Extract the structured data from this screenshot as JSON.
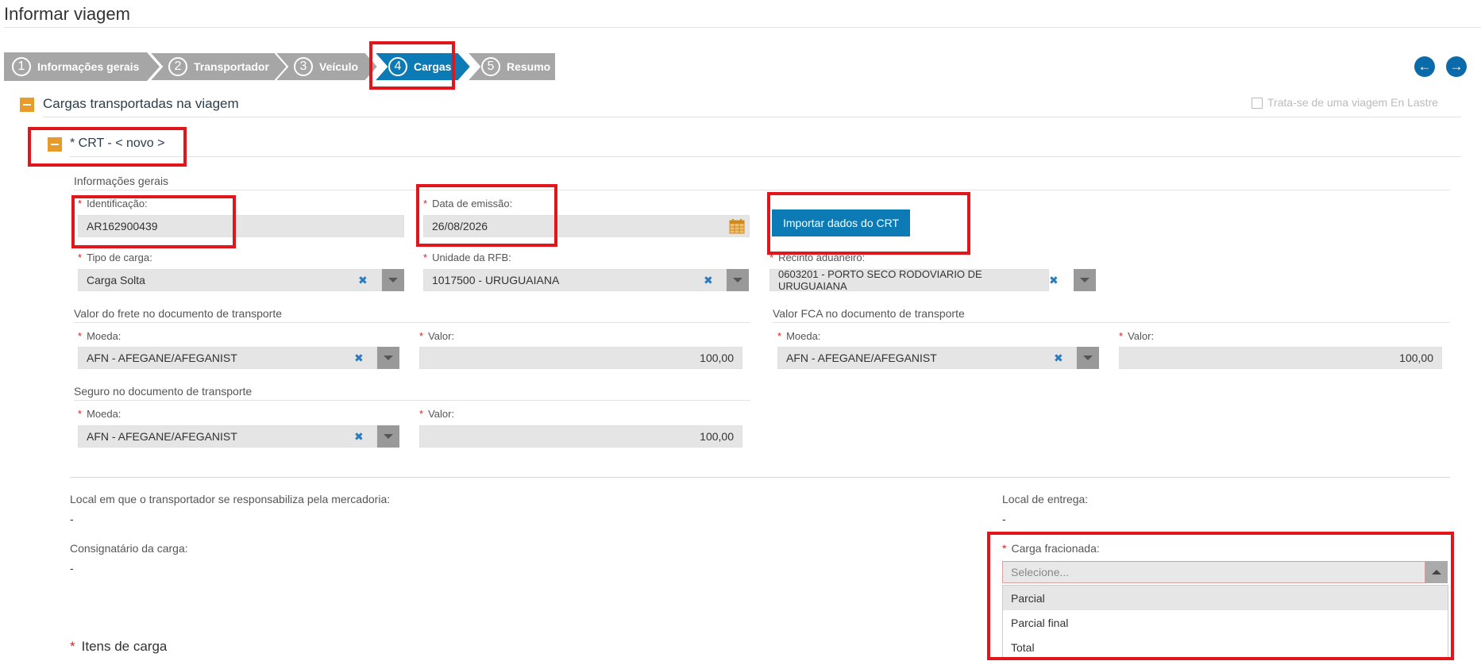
{
  "page": {
    "title": "Informar viagem"
  },
  "wizard": {
    "steps": [
      {
        "num": "1",
        "label": "Informações gerais"
      },
      {
        "num": "2",
        "label": "Transportador"
      },
      {
        "num": "3",
        "label": "Veículo"
      },
      {
        "num": "4",
        "label": "Cargas"
      },
      {
        "num": "5",
        "label": "Resumo"
      }
    ],
    "active_step": 4
  },
  "nav": {
    "prev_icon": "arrow-left-icon",
    "next_icon": "arrow-right-icon"
  },
  "section": {
    "title": "Cargas transportadas na viagem",
    "lastre_label": "Trata-se de uma viagem En Lastre"
  },
  "crt": {
    "title": "* CRT - < novo >",
    "general_heading": "Informações gerais",
    "identificacao": {
      "label": "Identificação:",
      "value": "AR162900439"
    },
    "data_emissao": {
      "label": "Data de emissão:",
      "value": "26/08/2026"
    },
    "import_button": "Importar dados do CRT",
    "tipo_carga": {
      "label": "Tipo de carga:",
      "value": "Carga Solta"
    },
    "unidade_rfb": {
      "label": "Unidade da RFB:",
      "value": "1017500 - URUGUAIANA"
    },
    "recinto": {
      "label": "Recinto aduaneiro:",
      "value": "0603201 - PORTO SECO RODOVIARIO DE URUGUAIANA"
    },
    "frete": {
      "heading": "Valor do frete no documento de transporte",
      "moeda_label": "Moeda:",
      "moeda_value": "AFN - AFEGANE/AFEGANIST",
      "valor_label": "Valor:",
      "valor_value": "100,00"
    },
    "fca": {
      "heading": "Valor FCA no documento de transporte",
      "moeda_label": "Moeda:",
      "moeda_value": "AFN - AFEGANE/AFEGANIST",
      "valor_label": "Valor:",
      "valor_value": "100,00"
    },
    "seguro": {
      "heading": "Seguro no documento de transporte",
      "moeda_label": "Moeda:",
      "moeda_value": "AFN - AFEGANE/AFEGANIST",
      "valor_label": "Valor:",
      "valor_value": "100,00"
    },
    "local_responsabiliza": {
      "label": "Local em que o transportador se responsabiliza pela mercadoria:",
      "value": "-"
    },
    "local_entrega": {
      "label": "Local de entrega:",
      "value": "-"
    },
    "consignatario": {
      "label": "Consignatário da carga:",
      "value": "-"
    },
    "carga_fracionada": {
      "label": "Carga fracionada:",
      "placeholder": "Selecione...",
      "options": [
        "Parcial",
        "Parcial final",
        "Total"
      ]
    },
    "itens_title": "Itens de carga"
  },
  "colors": {
    "accent": "#0b7ab5",
    "step_inactive": "#a6a6a6",
    "toggle": "#e69b2b",
    "highlight": "#e0161b"
  }
}
